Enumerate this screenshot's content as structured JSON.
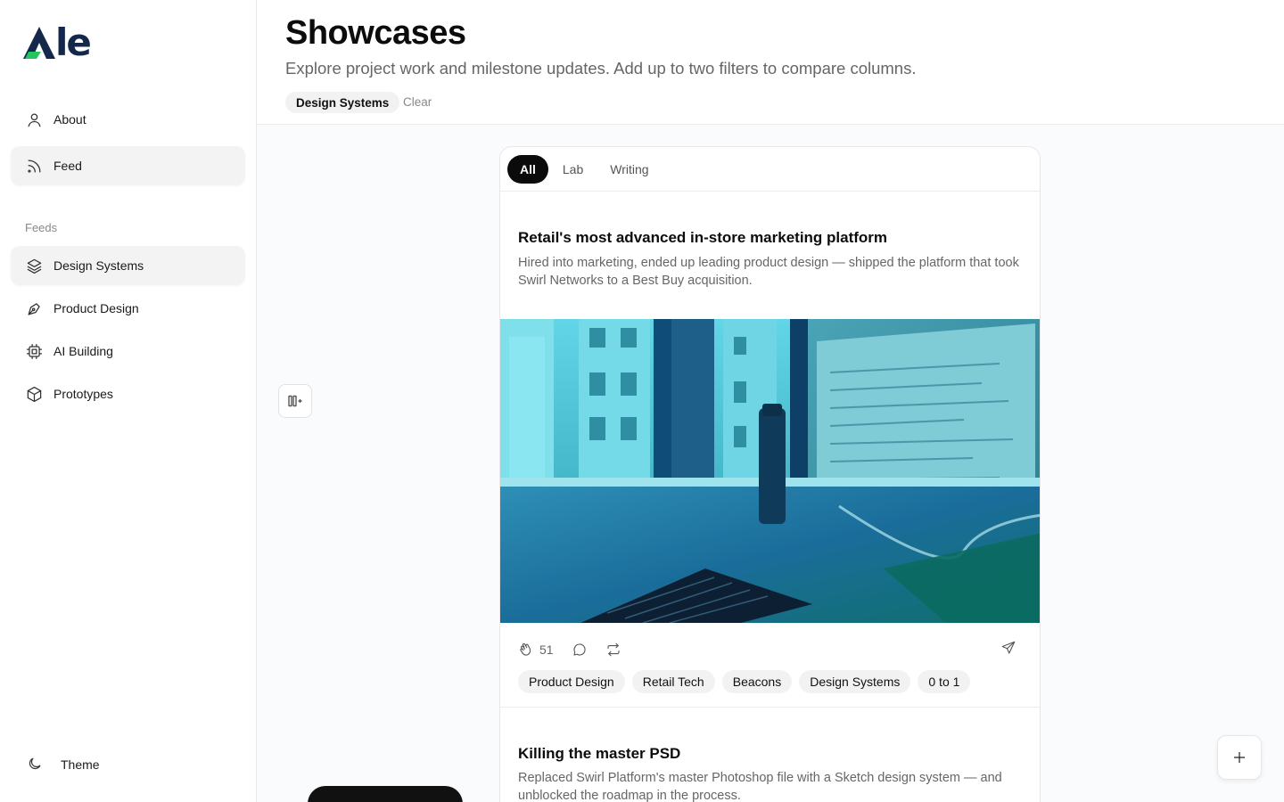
{
  "brand": {
    "logo_text": "le"
  },
  "sidebar": {
    "items": [
      {
        "label": "About",
        "icon": "user-icon"
      },
      {
        "label": "Feed",
        "icon": "rss-icon",
        "active": true
      }
    ],
    "section_label": "Feeds",
    "feeds": [
      {
        "label": "Design Systems",
        "icon": "layers-icon",
        "active": true
      },
      {
        "label": "Product Design",
        "icon": "pen-tool-icon"
      },
      {
        "label": "AI Building",
        "icon": "cpu-icon"
      },
      {
        "label": "Prototypes",
        "icon": "cube-icon"
      }
    ],
    "theme_label": "Theme"
  },
  "header": {
    "title": "Showcases",
    "subtitle": "Explore project work and milestone updates. Add up to two filters to compare columns.",
    "active_filter": "Design Systems",
    "clear_label": "Clear"
  },
  "column": {
    "tabs": [
      {
        "label": "All",
        "active": true
      },
      {
        "label": "Lab"
      },
      {
        "label": "Writing"
      }
    ],
    "posts": [
      {
        "title": "Retail's most advanced in-store marketing platform",
        "description": "Hired into marketing, ended up leading product design — shipped the platform that took Swirl Networks to a Best Buy acquisition.",
        "claps": "51",
        "tags": [
          "Product Design",
          "Retail Tech",
          "Beacons",
          "Design Systems",
          "0 to 1"
        ]
      },
      {
        "title": "Killing the master PSD",
        "description": "Replaced Swirl Platform's master Photoshop file with a Sketch design system — and unblocked the roadmap in the process."
      }
    ]
  },
  "colors": {
    "accent": "#0b0b0b",
    "brand_green": "#22c55e",
    "brand_navy": "#13284a"
  }
}
